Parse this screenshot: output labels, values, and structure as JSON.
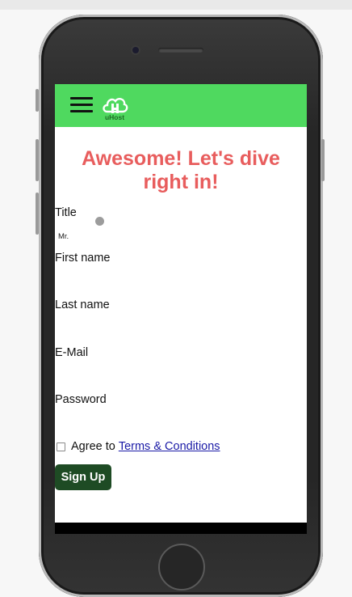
{
  "brand": {
    "logo_text": "uHost",
    "logo_letter": "H",
    "nav_color": "#4fd95f"
  },
  "hero": {
    "line1": "Awesome! Let's dive",
    "line2": "right in!",
    "color": "#e85d5d"
  },
  "form": {
    "title_label": "Title",
    "title_option": "Mr.",
    "first_name_label": "First name",
    "last_name_label": "Last name",
    "email_label": "E-Mail",
    "password_label": "Password",
    "agree_text": "Agree to",
    "terms_link": "Terms & Conditions",
    "signup_label": "Sign Up",
    "signup_color": "#1e4b24"
  },
  "icons": {
    "menu": "hamburger-icon",
    "logo": "cloud-logo-icon"
  }
}
